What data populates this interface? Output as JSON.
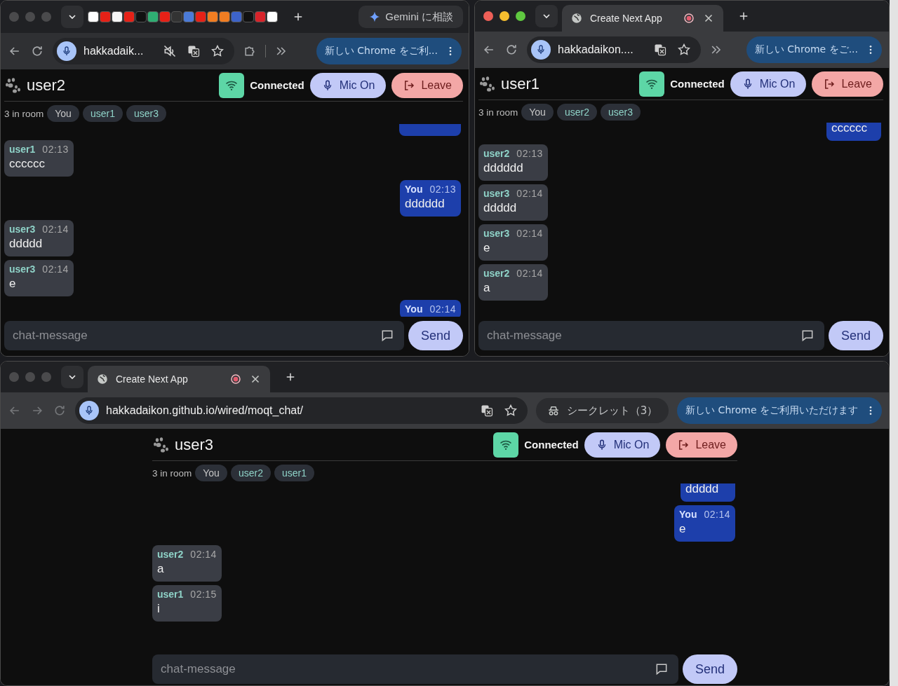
{
  "windows": [
    {
      "focused": false,
      "tab_strip": {
        "kind": "favicons",
        "gemini_button": "Gemini に相談"
      },
      "toolbar": {
        "nav": [
          {
            "kind": "back"
          },
          {
            "kind": "reload"
          }
        ],
        "url": "hakkadaik...",
        "omni_icons": [
          {
            "kind": "mute"
          },
          {
            "kind": "translate"
          },
          {
            "kind": "star"
          }
        ],
        "extras": [
          {
            "kind": "extensions"
          },
          {
            "kind": "separator"
          },
          {
            "kind": "overflow"
          }
        ],
        "update_chip": "新しい Chrome をご利..."
      },
      "app": {
        "centered": false,
        "user": "user2",
        "status": "Connected",
        "mic_button": "Mic On",
        "leave_button": "Leave",
        "room_count": "3 in room",
        "members": [
          {
            "name": "You",
            "self": true
          },
          {
            "name": "user1",
            "self": false
          },
          {
            "name": "user3",
            "self": false
          }
        ],
        "messages": [
          {
            "kind": "stub",
            "mine": true
          },
          {
            "kind": "full",
            "mine": false,
            "sender": "user1",
            "time": "02:13",
            "text": "cccccc"
          },
          {
            "kind": "full",
            "mine": true,
            "sender": "You",
            "time": "02:13",
            "text": "dddddd"
          },
          {
            "kind": "full",
            "mine": false,
            "sender": "user3",
            "time": "02:14",
            "text": "ddddd"
          },
          {
            "kind": "full",
            "mine": false,
            "sender": "user3",
            "time": "02:14",
            "text": "e"
          },
          {
            "kind": "clipped_bottom",
            "mine": true,
            "sender": "You",
            "time": "02:14"
          }
        ],
        "input": {
          "placeholder": "chat-message"
        },
        "send_button": "Send"
      }
    },
    {
      "focused": true,
      "tab_strip": {
        "kind": "tab",
        "tab": {
          "title": "Create Next App",
          "recording": true
        }
      },
      "toolbar": {
        "nav": [
          {
            "kind": "back"
          },
          {
            "kind": "reload"
          }
        ],
        "url": "hakkadaikon....",
        "omni_icons": [
          {
            "kind": "translate"
          },
          {
            "kind": "star"
          }
        ],
        "extras": [
          {
            "kind": "overflow"
          }
        ],
        "update_chip": "新しい Chrome をご..."
      },
      "app": {
        "centered": false,
        "user": "user1",
        "status": "Connected",
        "mic_button": "Mic On",
        "leave_button": "Leave",
        "room_count": "3 in room",
        "members": [
          {
            "name": "You",
            "self": true
          },
          {
            "name": "user2",
            "self": false
          },
          {
            "name": "user3",
            "self": false
          }
        ],
        "messages": [
          {
            "kind": "clipped_top",
            "mine": true,
            "text": "cccccc"
          },
          {
            "kind": "full",
            "mine": false,
            "sender": "user2",
            "time": "02:13",
            "text": "dddddd"
          },
          {
            "kind": "full",
            "mine": false,
            "sender": "user3",
            "time": "02:14",
            "text": "ddddd"
          },
          {
            "kind": "full",
            "mine": false,
            "sender": "user3",
            "time": "02:14",
            "text": "e"
          },
          {
            "kind": "full",
            "mine": false,
            "sender": "user2",
            "time": "02:14",
            "text": "a"
          }
        ],
        "input": {
          "placeholder": "chat-message"
        },
        "send_button": "Send"
      }
    },
    {
      "focused": false,
      "tab_strip": {
        "kind": "tab",
        "tab": {
          "title": "Create Next App",
          "recording": true
        }
      },
      "toolbar": {
        "nav": [
          {
            "kind": "back"
          },
          {
            "kind": "forward"
          },
          {
            "kind": "reload"
          }
        ],
        "url": "hakkadaikon.github.io/wired/moqt_chat/",
        "omni_icons": [
          {
            "kind": "translate"
          },
          {
            "kind": "star"
          }
        ],
        "incognito": "シークレット（3）",
        "update_chip": "新しい Chrome をご利用いただけます"
      },
      "app": {
        "centered": true,
        "user": "user3",
        "status": "Connected",
        "mic_button": "Mic On",
        "leave_button": "Leave",
        "room_count": "3 in room",
        "members": [
          {
            "name": "You",
            "self": true
          },
          {
            "name": "user2",
            "self": false
          },
          {
            "name": "user1",
            "self": false
          }
        ],
        "messages": [
          {
            "kind": "clipped_top",
            "mine": true,
            "text": "ddddd"
          },
          {
            "kind": "full",
            "mine": true,
            "sender": "You",
            "time": "02:14",
            "text": "e"
          },
          {
            "kind": "full",
            "mine": false,
            "sender": "user2",
            "time": "02:14",
            "text": "a"
          },
          {
            "kind": "full",
            "mine": false,
            "sender": "user1",
            "time": "02:15",
            "text": "i"
          }
        ],
        "input": {
          "placeholder": "chat-message"
        },
        "send_button": "Send"
      }
    }
  ]
}
